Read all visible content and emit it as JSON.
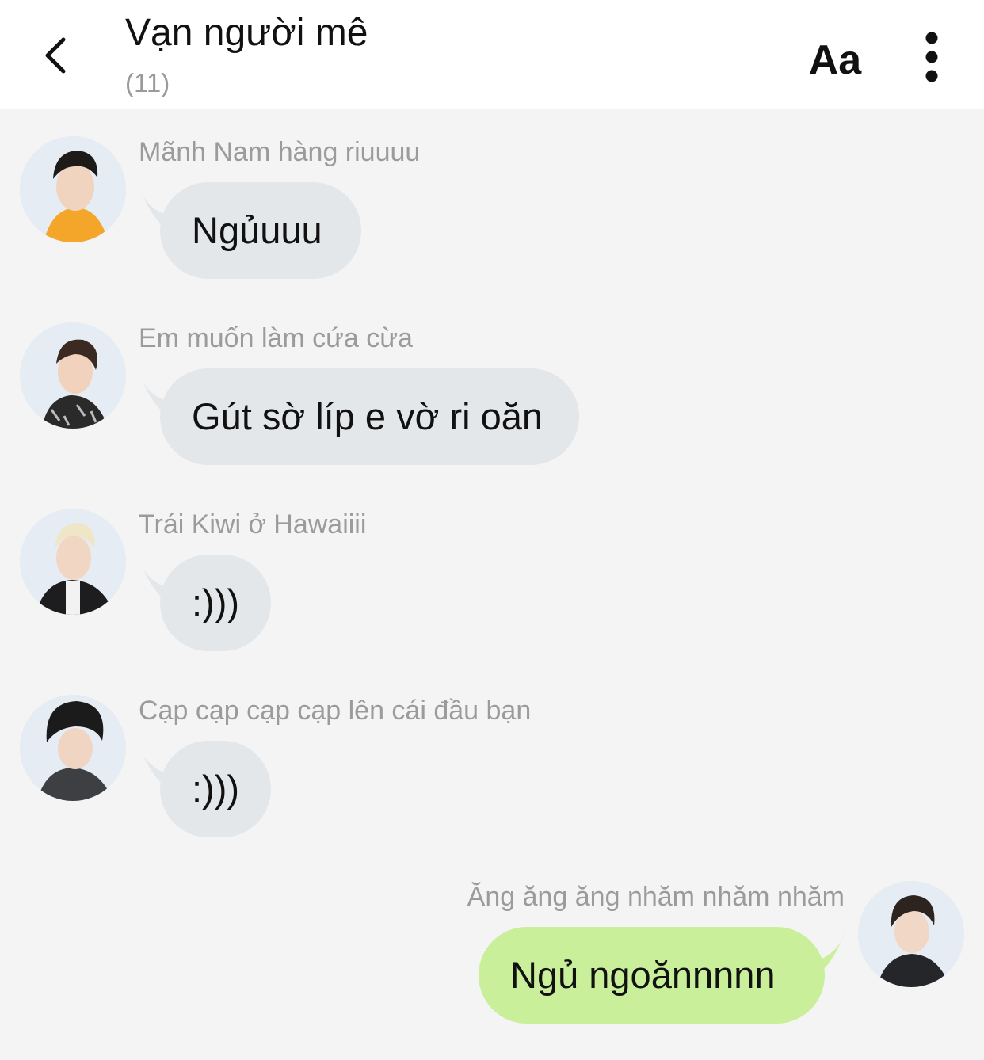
{
  "header": {
    "title": "Vạn người mê",
    "member_count": "(11)",
    "font_button": "Aa"
  },
  "messages": [
    {
      "sender": "Mãnh Nam hàng riuuuu",
      "text": "Ngủuuu",
      "mine": false
    },
    {
      "sender": "Em muốn làm cứa cừa",
      "text": "Gút sờ líp e vờ ri oăn",
      "mine": false
    },
    {
      "sender": "Trái Kiwi ở Hawaiiii",
      "text": ":)))",
      "mine": false
    },
    {
      "sender": "Cạp cạp cạp cạp lên cái đầu bạn",
      "text": ":)))",
      "mine": false
    },
    {
      "sender": "Ăng ăng ăng nhăm nhăm nhăm",
      "text": "Ngủ ngoănnnnn",
      "mine": true
    }
  ],
  "colors": {
    "background": "#f4f4f4",
    "header": "#ffffff",
    "incoming_bubble": "#e4e7ea",
    "outgoing_bubble": "#c9ef9a",
    "sender_text": "#9b9b9b"
  },
  "icons": {
    "back": "chevron-left-icon",
    "more": "vertical-dots-icon"
  }
}
